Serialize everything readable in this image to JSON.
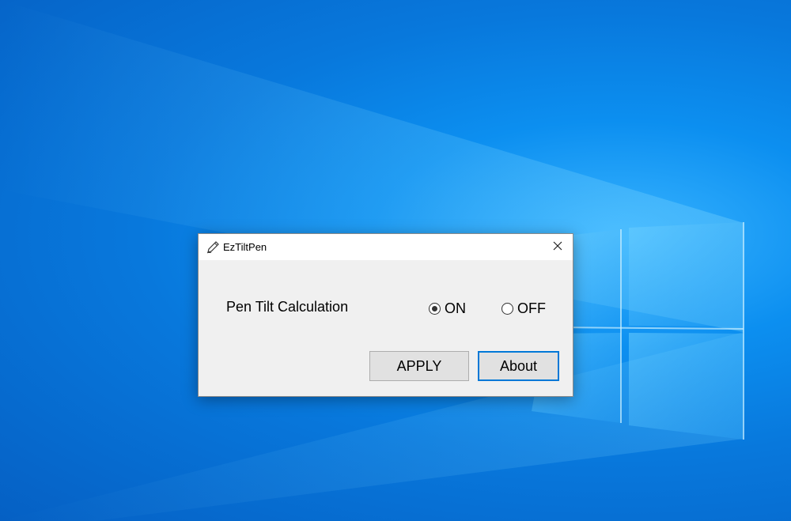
{
  "window": {
    "title": "EzTiltPen",
    "icon": "pen-icon",
    "close_icon": "close-icon"
  },
  "setting": {
    "label": "Pen Tilt Calculation",
    "options": [
      {
        "label": "ON",
        "selected": true
      },
      {
        "label": "OFF",
        "selected": false
      }
    ]
  },
  "buttons": {
    "apply_label": "APPLY",
    "about_label": "About"
  },
  "colors": {
    "desktop_accent": "#0a7fe6",
    "dialog_background": "#f0f0f0",
    "titlebar_background": "#ffffff",
    "focus_border": "#0078d7"
  }
}
